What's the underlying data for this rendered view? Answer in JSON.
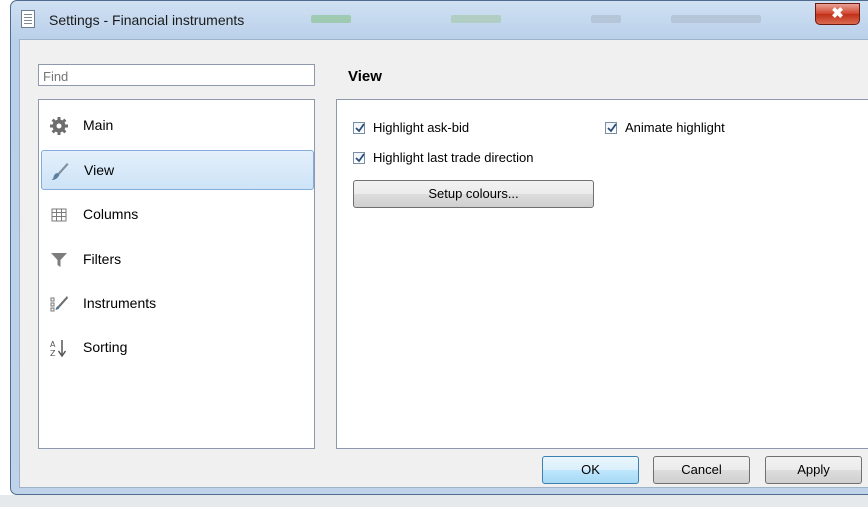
{
  "window": {
    "title": "Settings - Financial instruments",
    "close_symbol": "✖"
  },
  "search": {
    "placeholder": "Find"
  },
  "nav": {
    "items": [
      {
        "label": "Main",
        "icon": "gear-icon"
      },
      {
        "label": "View",
        "icon": "brush-icon",
        "selected": true
      },
      {
        "label": "Columns",
        "icon": "grid-icon"
      },
      {
        "label": "Filters",
        "icon": "funnel-icon"
      },
      {
        "label": "Instruments",
        "icon": "instruments-icon"
      },
      {
        "label": "Sorting",
        "icon": "sort-az-icon"
      }
    ]
  },
  "view": {
    "title": "View",
    "options": {
      "highlight_ask_bid": {
        "label": "Highlight ask-bid",
        "checked": true
      },
      "animate_highlight": {
        "label": "Animate highlight",
        "checked": true
      },
      "highlight_last_trade": {
        "label": "Highlight last trade direction",
        "checked": true
      }
    },
    "setup_colours_label": "Setup colours..."
  },
  "footer": {
    "ok": "OK",
    "cancel": "Cancel",
    "apply": "Apply"
  },
  "colors": {
    "accent": "#84acdd",
    "title_bar": "#c3d7ee",
    "close": "#c8402a"
  }
}
